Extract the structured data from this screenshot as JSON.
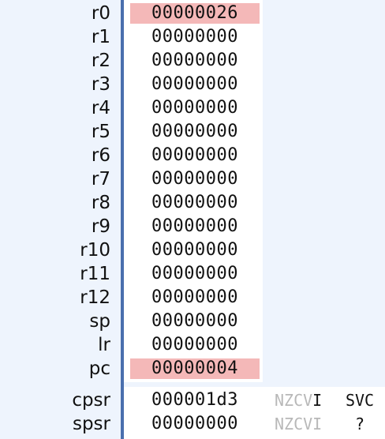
{
  "registers": [
    {
      "name": "r0",
      "value": "00000026",
      "changed": true
    },
    {
      "name": "r1",
      "value": "00000000",
      "changed": false
    },
    {
      "name": "r2",
      "value": "00000000",
      "changed": false
    },
    {
      "name": "r3",
      "value": "00000000",
      "changed": false
    },
    {
      "name": "r4",
      "value": "00000000",
      "changed": false
    },
    {
      "name": "r5",
      "value": "00000000",
      "changed": false
    },
    {
      "name": "r6",
      "value": "00000000",
      "changed": false
    },
    {
      "name": "r7",
      "value": "00000000",
      "changed": false
    },
    {
      "name": "r8",
      "value": "00000000",
      "changed": false
    },
    {
      "name": "r9",
      "value": "00000000",
      "changed": false
    },
    {
      "name": "r10",
      "value": "00000000",
      "changed": false
    },
    {
      "name": "r11",
      "value": "00000000",
      "changed": false
    },
    {
      "name": "r12",
      "value": "00000000",
      "changed": false
    },
    {
      "name": "sp",
      "value": "00000000",
      "changed": false
    },
    {
      "name": "lr",
      "value": "00000000",
      "changed": false
    },
    {
      "name": "pc",
      "value": "00000004",
      "changed": true
    }
  ],
  "status_registers": {
    "cpsr": {
      "name": "cpsr",
      "value": "000001d3",
      "flags_off": "NZCV",
      "flags_on": "I",
      "mode": "SVC"
    },
    "spsr": {
      "name": "spsr",
      "value": "00000000",
      "flags_off": "NZCVI",
      "flags_on": "",
      "mode": "?"
    }
  },
  "colors": {
    "background": "#eef4fd",
    "value_background": "#ffffff",
    "changed_highlight": "#f4b8b8",
    "divider": "#4a6fae",
    "flag_inactive": "#b8b8b8"
  }
}
